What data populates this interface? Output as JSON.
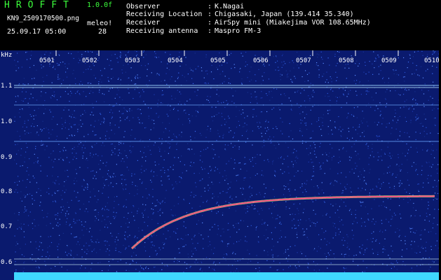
{
  "header": {
    "app_title": "HROFFT",
    "version": "1.0.0f",
    "file_name": "KN9_2509170500.png",
    "meteo_label": "meleo!",
    "count": "28",
    "datetime": "25.09.17 05:00"
  },
  "meta": [
    {
      "label": "Observer",
      "value": "K.Nagai"
    },
    {
      "label": "Receiving Location",
      "value": "Chigasaki, Japan (139.414 35.340)"
    },
    {
      "label": "Receiver",
      "value": "AirSpy mini (Miakejima VOR 108.65MHz)"
    },
    {
      "label": "Receiving antenna",
      "value": "Maspro FM-3"
    }
  ],
  "spectrogram": {
    "y_unit": "kHz",
    "y_ticks": [
      "1.1",
      "1.0",
      "0.9",
      "0.8",
      "0.7",
      "0.6"
    ],
    "x_ticks": [
      "0501",
      "0502",
      "0503",
      "0504",
      "0505",
      "0506",
      "0507",
      "0508",
      "0509",
      "0510"
    ],
    "colors": {
      "background": "#0a1a6e",
      "trace": "#ff3c8c",
      "band": "#3fd8ff",
      "label": "#3cff3c"
    }
  }
}
